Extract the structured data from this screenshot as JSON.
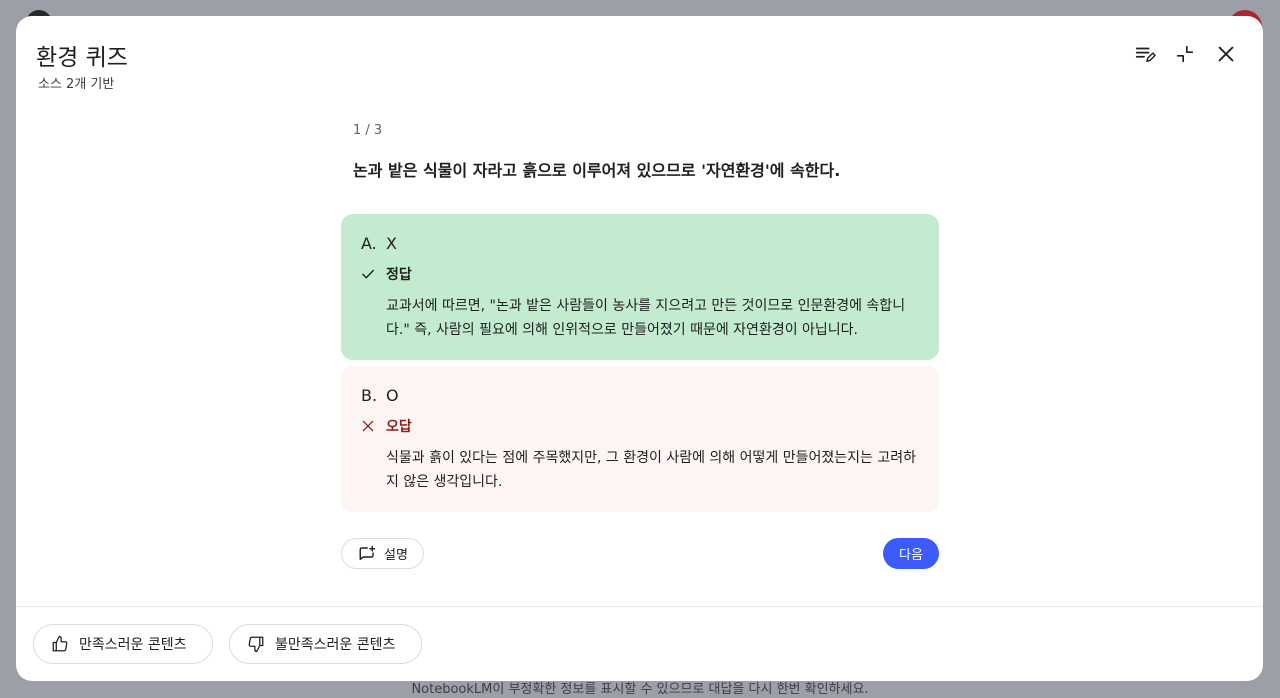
{
  "background": {
    "footer_notice": "NotebookLM이 부정확한 정보를 표시할 수 있으므로 대답을 다시 한번 확인하세요."
  },
  "header": {
    "title": "환경 퀴즈",
    "subtitle": "소스 2개 기반",
    "icons": [
      "edit-list-icon",
      "collapse-icon",
      "close-icon"
    ]
  },
  "quiz": {
    "counter": "1 / 3",
    "question": "논과 밭은 식물이 자라고 흙으로 이루어져 있으므로 '자연환경'에 속한다.",
    "options": [
      {
        "letter": "A.",
        "text": "X",
        "verdict": "정답",
        "explanation": "교과서에 따르면, \"논과 밭은 사람들이 농사를 지으려고 만든 것이므로 인문환경에 속합니다.\" 즉, 사람의 필요에 의해 인위적으로 만들어졌기 때문에 자연환경이 아닙니다.",
        "status": "correct",
        "color": "#c3ebd0"
      },
      {
        "letter": "B.",
        "text": "O",
        "verdict": "오답",
        "explanation": "식물과 흙이 있다는 점에 주목했지만, 그 환경이 사람에 의해 어떻게 만들어졌는지는 고려하지 않은 생각입니다.",
        "status": "incorrect",
        "color": "#fdf5f4"
      }
    ],
    "explain_label": "설명",
    "next_label": "다음"
  },
  "feedback": {
    "good_label": "만족스러운 콘텐츠",
    "bad_label": "불만족스러운 콘텐츠"
  },
  "colors": {
    "accent": "#3b5bfb",
    "correct_bg": "#c3ebd0",
    "wrong_bg": "#fdf5f4",
    "wrong_text": "#8c1d18"
  }
}
